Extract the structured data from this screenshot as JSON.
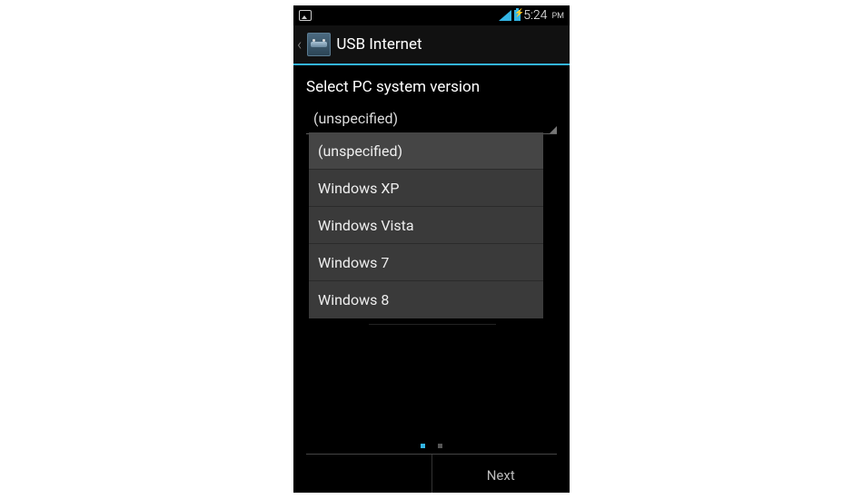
{
  "status_bar": {
    "time": "5:24",
    "period": "PM"
  },
  "action_bar": {
    "title": "USB Internet"
  },
  "content": {
    "section_label": "Select PC system version",
    "spinner_value": "(unspecified)"
  },
  "dropdown": {
    "options": [
      "(unspecified)",
      "Windows XP",
      "Windows Vista",
      "Windows 7",
      "Windows 8"
    ]
  },
  "footer": {
    "pages": 2,
    "active_page": 0,
    "next_label": "Next"
  }
}
